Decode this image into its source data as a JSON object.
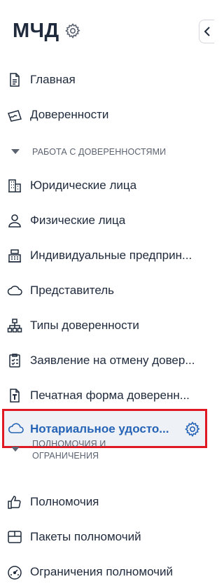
{
  "app": {
    "title": "МЧД"
  },
  "nav": {
    "top_items": [
      {
        "label": "Главная",
        "icon": "document-icon"
      },
      {
        "label": "Доверенности",
        "icon": "signed-document-icon"
      }
    ],
    "section_work": {
      "label": "РАБОТА С ДОВЕРЕННОСТЯМИ",
      "expanded": true
    },
    "work_items": [
      {
        "label": "Юридические лица",
        "icon": "building-icon"
      },
      {
        "label": "Физические лица",
        "icon": "person-icon"
      },
      {
        "label": "Индивидуальные предприн...",
        "icon": "cash-register-icon"
      },
      {
        "label": "Представитель",
        "icon": "cloud-icon"
      },
      {
        "label": "Типы доверенности",
        "icon": "hierarchy-icon"
      },
      {
        "label": "Заявление на отмену довер...",
        "icon": "checklist-icon"
      },
      {
        "label": "Печатная форма доверенн...",
        "icon": "print-form-icon"
      }
    ],
    "active_item": {
      "label": "Нотариальное удосто...",
      "icon": "cloud-icon",
      "settings_icon": "gear-icon"
    },
    "section_powers": {
      "label_line1": "ПОЛНОМОЧИЯ И",
      "label_line2": "ОГРАНИЧЕНИЯ",
      "expanded": true
    },
    "powers_items": [
      {
        "label": "Полномочия",
        "icon": "thumbs-up-icon"
      },
      {
        "label": "Пакеты полномочий",
        "icon": "package-icon"
      },
      {
        "label": "Ограничения полномочий",
        "icon": "gauge-icon"
      }
    ]
  },
  "colors": {
    "text": "#1f2a3c",
    "active_text": "#2563b6",
    "active_bg": "#eef1f6",
    "highlight_border": "#e01822",
    "section_text": "#5b6270"
  }
}
